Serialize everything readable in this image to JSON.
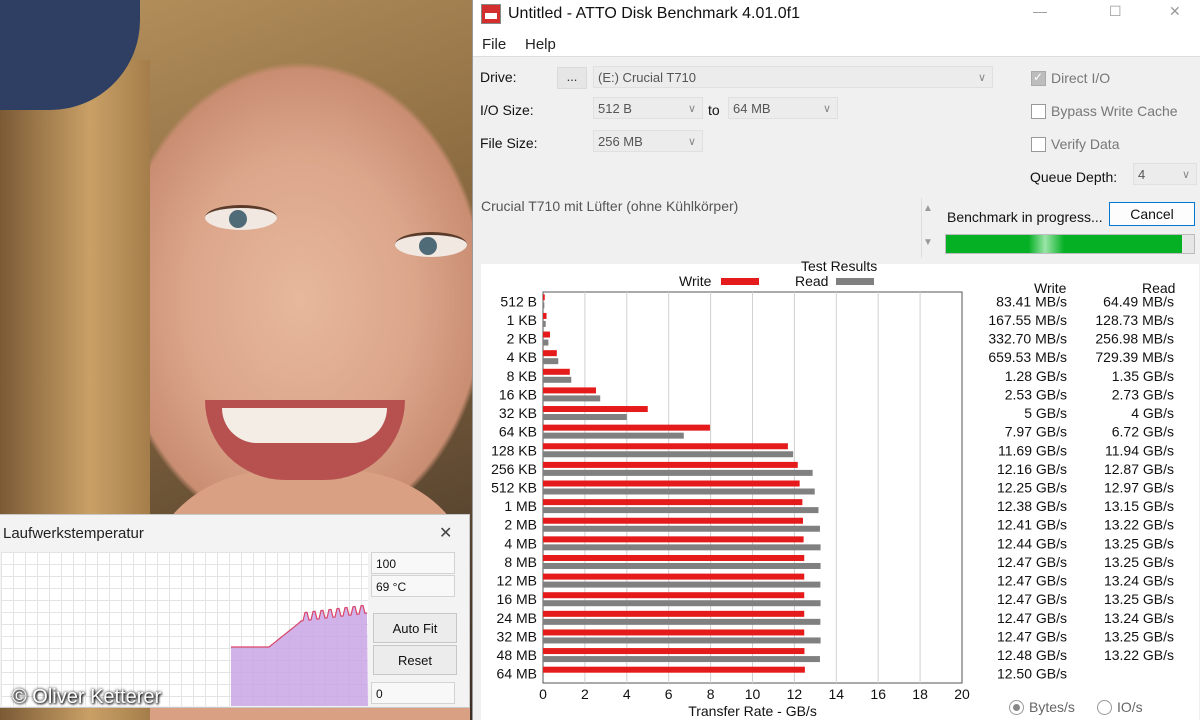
{
  "watermark": "© Oliver Ketterer",
  "temp_window": {
    "title": "Laufwerkstemperatur",
    "max_value": "100",
    "current_temp": "69 °C",
    "auto_fit_label": "Auto Fit",
    "reset_label": "Reset",
    "min_value": "0",
    "line_color": "#d9456a",
    "fill_color": "#c9a6e6"
  },
  "atto": {
    "title": "Untitled - ATTO Disk Benchmark 4.01.0f1",
    "menu": {
      "file": "File",
      "help": "Help"
    },
    "drive_label": "Drive:",
    "browse_label": "...",
    "drive_value": "(E:) Crucial T710",
    "io_size_label": "I/O Size:",
    "io_from": "512 B",
    "to_label": "to",
    "io_to": "64 MB",
    "file_size_label": "File Size:",
    "file_size": "256 MB",
    "direct_io": "Direct I/O",
    "bypass_cache": "Bypass Write Cache",
    "verify_data": "Verify Data",
    "queue_depth_label": "Queue Depth:",
    "queue_depth": "4",
    "description": "Crucial T710 mit Lüfter (ohne Kühlkörper)",
    "status": "Benchmark in progress...",
    "cancel_label": "Cancel",
    "progress": 0.95,
    "results_title": "Test Results",
    "legend_write": "Write",
    "legend_read": "Read",
    "col_write": "Write",
    "col_read": "Read",
    "radio_bytes": "Bytes/s",
    "radio_io": "IO/s",
    "write_color": "#e51a1a",
    "read_color": "#808080"
  },
  "chart_data": {
    "type": "bar",
    "orientation": "horizontal",
    "xlabel": "Transfer Rate - GB/s",
    "xlim": [
      0,
      20
    ],
    "xticks": [
      "0",
      "2",
      "4",
      "6",
      "8",
      "10",
      "12",
      "14",
      "16",
      "18",
      "20"
    ],
    "grid": true,
    "categories": [
      "512 B",
      "1 KB",
      "2 KB",
      "4 KB",
      "8 KB",
      "16 KB",
      "32 KB",
      "64 KB",
      "128 KB",
      "256 KB",
      "512 KB",
      "1 MB",
      "2 MB",
      "4 MB",
      "8 MB",
      "12 MB",
      "16 MB",
      "24 MB",
      "32 MB",
      "48 MB",
      "64 MB"
    ],
    "series": [
      {
        "name": "Write",
        "values": [
          0.083,
          0.168,
          0.333,
          0.66,
          1.28,
          2.53,
          5,
          7.97,
          11.69,
          12.16,
          12.25,
          12.38,
          12.41,
          12.44,
          12.47,
          12.47,
          12.47,
          12.47,
          12.47,
          12.48,
          12.5
        ]
      },
      {
        "name": "Read",
        "values": [
          0.064,
          0.129,
          0.257,
          0.729,
          1.35,
          2.73,
          4,
          6.72,
          11.94,
          12.87,
          12.97,
          13.15,
          13.22,
          13.25,
          13.25,
          13.24,
          13.25,
          13.24,
          13.25,
          13.22,
          null
        ]
      }
    ],
    "write_text": [
      "83.41 MB/s",
      "167.55 MB/s",
      "332.70 MB/s",
      "659.53 MB/s",
      "1.28 GB/s",
      "2.53 GB/s",
      "5 GB/s",
      "7.97 GB/s",
      "11.69 GB/s",
      "12.16 GB/s",
      "12.25 GB/s",
      "12.38 GB/s",
      "12.41 GB/s",
      "12.44 GB/s",
      "12.47 GB/s",
      "12.47 GB/s",
      "12.47 GB/s",
      "12.47 GB/s",
      "12.47 GB/s",
      "12.48 GB/s",
      "12.50 GB/s"
    ],
    "read_text": [
      "64.49 MB/s",
      "128.73 MB/s",
      "256.98 MB/s",
      "729.39 MB/s",
      "1.35 GB/s",
      "2.73 GB/s",
      "4 GB/s",
      "6.72 GB/s",
      "11.94 GB/s",
      "12.87 GB/s",
      "12.97 GB/s",
      "13.15 GB/s",
      "13.22 GB/s",
      "13.25 GB/s",
      "13.25 GB/s",
      "13.24 GB/s",
      "13.25 GB/s",
      "13.24 GB/s",
      "13.25 GB/s",
      "13.22 GB/s",
      ""
    ]
  }
}
